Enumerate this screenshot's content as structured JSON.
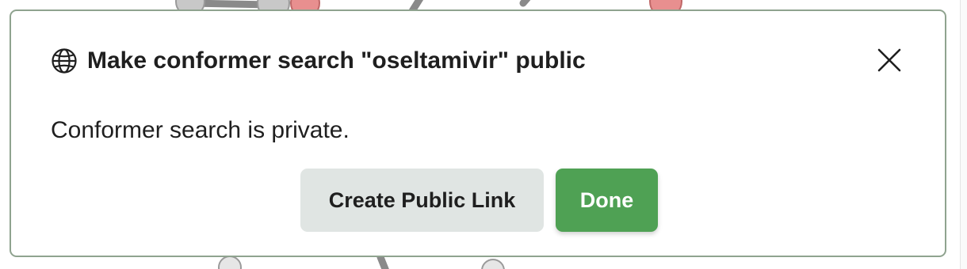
{
  "dialog": {
    "title": "Make conformer search \"oseltamivir\" public",
    "message": "Conformer search is private.",
    "title_icon": "globe-icon",
    "close_icon": "close-icon"
  },
  "actions": {
    "create_public_link_label": "Create Public Link",
    "done_label": "Done"
  },
  "colors": {
    "dialog_border": "#8fa38f",
    "primary_button": "#4fa154",
    "secondary_button": "#e0e5e3",
    "text": "#1f1f1f"
  }
}
